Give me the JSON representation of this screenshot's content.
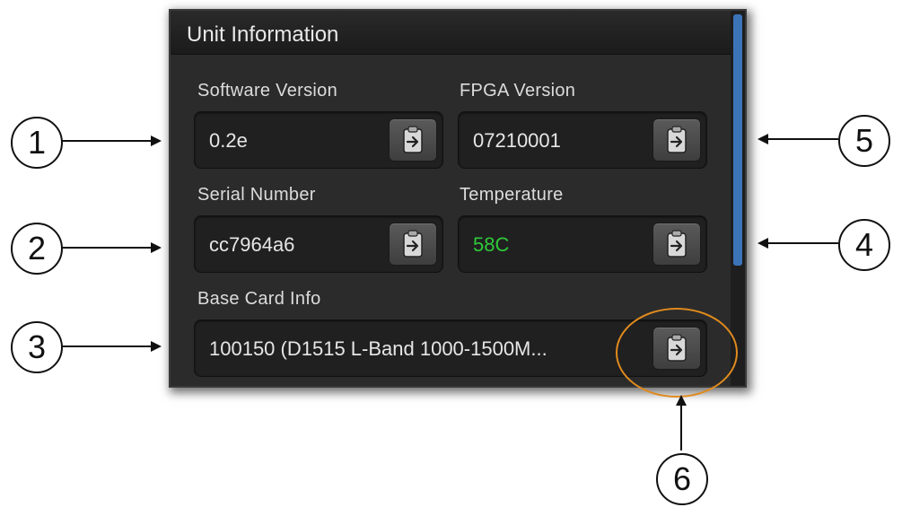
{
  "panel": {
    "title": "Unit Information"
  },
  "fields": {
    "software_version": {
      "label": "Software Version",
      "value": "0.2e"
    },
    "fpga_version": {
      "label": "FPGA Version",
      "value": "07210001"
    },
    "serial_number": {
      "label": "Serial Number",
      "value": "cc7964a6"
    },
    "temperature": {
      "label": "Temperature",
      "value": "58C",
      "value_color": "#2ec93a"
    },
    "base_card_info": {
      "label": "Base Card Info",
      "value": "100150 (D1515 L-Band 1000-1500M..."
    }
  },
  "icons": {
    "copy": "copy-clipboard-icon"
  },
  "callouts": [
    "1",
    "2",
    "3",
    "4",
    "5",
    "6"
  ],
  "colors": {
    "highlight_ring": "#e08a1e",
    "scrollbar_thumb": "#3c74b8"
  }
}
